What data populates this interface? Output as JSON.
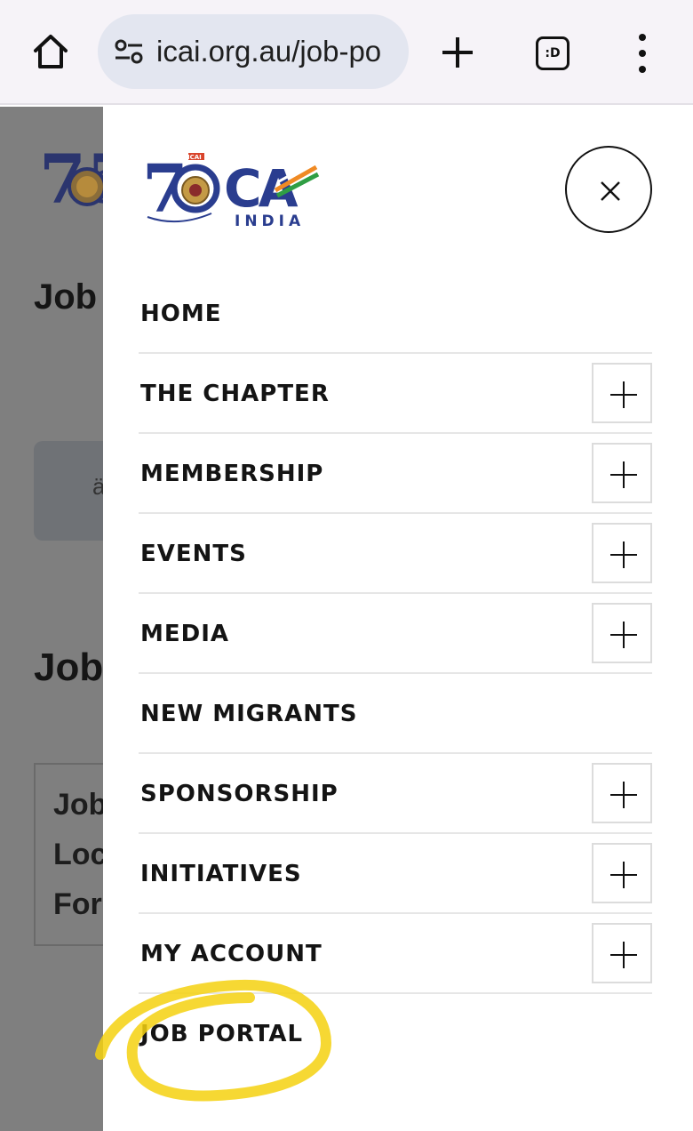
{
  "browser": {
    "url": "icai.org.au/job-po",
    "tabs_count": ":D",
    "icons": [
      "home-icon",
      "site-info-icon",
      "new-tab-icon",
      "tab-switcher-icon",
      "more-menu-icon"
    ]
  },
  "background_page": {
    "heading_1": "Job",
    "heading_2": "Job",
    "card_fragment": "ä",
    "box_lines": [
      "Job",
      "Loc",
      "For"
    ]
  },
  "drawer": {
    "logo": "ICAI 75 CA INDIA logo",
    "logo_text": {
      "badge": "ICAI",
      "ca": "CA",
      "india": "INDIA"
    },
    "nav_items": [
      {
        "label": "HOME",
        "expandable": false
      },
      {
        "label": "THE CHAPTER",
        "expandable": true
      },
      {
        "label": "MEMBERSHIP",
        "expandable": true
      },
      {
        "label": "EVENTS",
        "expandable": true
      },
      {
        "label": "MEDIA",
        "expandable": true
      },
      {
        "label": "NEW MIGRANTS",
        "expandable": false
      },
      {
        "label": "SPONSORSHIP",
        "expandable": true
      },
      {
        "label": "INITIATIVES",
        "expandable": true
      },
      {
        "label": "MY ACCOUNT",
        "expandable": true
      },
      {
        "label": "JOB PORTAL",
        "expandable": false
      }
    ],
    "highlighted_item": "JOB PORTAL"
  },
  "colors": {
    "chrome_bg": "#f6f3f8",
    "url_pill": "#e3e6f0",
    "overlay": "#7f7f7f",
    "logo_blue": "#2a3d8f",
    "highlight": "#f5d10f"
  }
}
